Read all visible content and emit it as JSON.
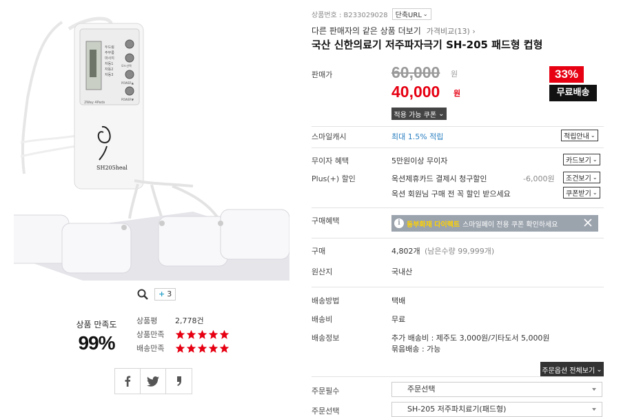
{
  "product": {
    "code_label": "상품번호 : B233029028",
    "short_url_label": "단축URL",
    "other_sellers_label": "다른 판매자의 같은 상품 더보기",
    "price_compare_label": "가격비교(13)",
    "title": "국산 신한의료기 저주파자극기 SH-205 패드형 컵형"
  },
  "image": {
    "more_count": "3",
    "device_top_label": "2Way 4Pads",
    "device_logo_text": "SH205heal",
    "mode_labels": [
      "두드림",
      "주무름",
      "마사지",
      "자동1",
      "자동2",
      "자동3"
    ],
    "button_labels": [
      "모드선택",
      "POWER▲",
      "POWER▼"
    ]
  },
  "satisfaction": {
    "label": "상품 만족도",
    "value": "99%",
    "review_label": "상품평",
    "review_count": "2,778건",
    "product_label": "상품만족",
    "delivery_label": "배송만족",
    "product_stars": 5,
    "delivery_stars": 5
  },
  "price": {
    "label": "판매가",
    "original": "60,000",
    "original_unit": "원",
    "sale": "40,000",
    "sale_unit": "원",
    "discount": "33%",
    "free_shipping": "무료배송",
    "coupon_button": "적용 가능 쿠폰"
  },
  "smile_cash": {
    "label": "스마일캐시",
    "value": "최대 1.5% 적립",
    "button": "적립안내"
  },
  "benefits": {
    "interest_label": "무이자 혜택",
    "interest_value": "5만원이상 무이자",
    "card_button": "카드보기",
    "plus_label": "Plus(+) 할인",
    "plus_value": "옥션제휴카드 결제시 청구할인",
    "plus_amount": "-6,000원",
    "condition_button": "조건보기",
    "member_value": "옥션 회원님 구매 전 꼭 할인 받으세요",
    "coupon_button": "쿠폰받기"
  },
  "purchase_benefit": {
    "label": "구매혜택",
    "highlight": "동부화재 다이렉트",
    "text": "스마일페이 전용 쿠폰 확인하세요"
  },
  "purchase": {
    "label": "구매",
    "count": "4,802개",
    "remain": "(남은수량 99,999개)",
    "origin_label": "원산지",
    "origin_value": "국내산"
  },
  "delivery": {
    "method_label": "배송방법",
    "method_value": "택배",
    "fee_label": "배송비",
    "fee_value": "무료",
    "info_label": "배송정보",
    "info_line1": "추가 배송비 : 제주도 3,000원/기타도서 5,000원",
    "info_line2": "묶음배송 : 가능"
  },
  "order": {
    "options_toggle": "주문옵션 전체보기",
    "required_label": "주문필수",
    "required_value": "주문선택",
    "select_label": "주문선택",
    "select_value": "SH-205 저주파치료기(패드형)"
  },
  "colors": {
    "sale_red": "#e60012",
    "link_blue": "#2a7fc0",
    "star_red": "#e60012",
    "banner_gray": "#9ba3ad",
    "banner_highlight": "#ffd200"
  }
}
